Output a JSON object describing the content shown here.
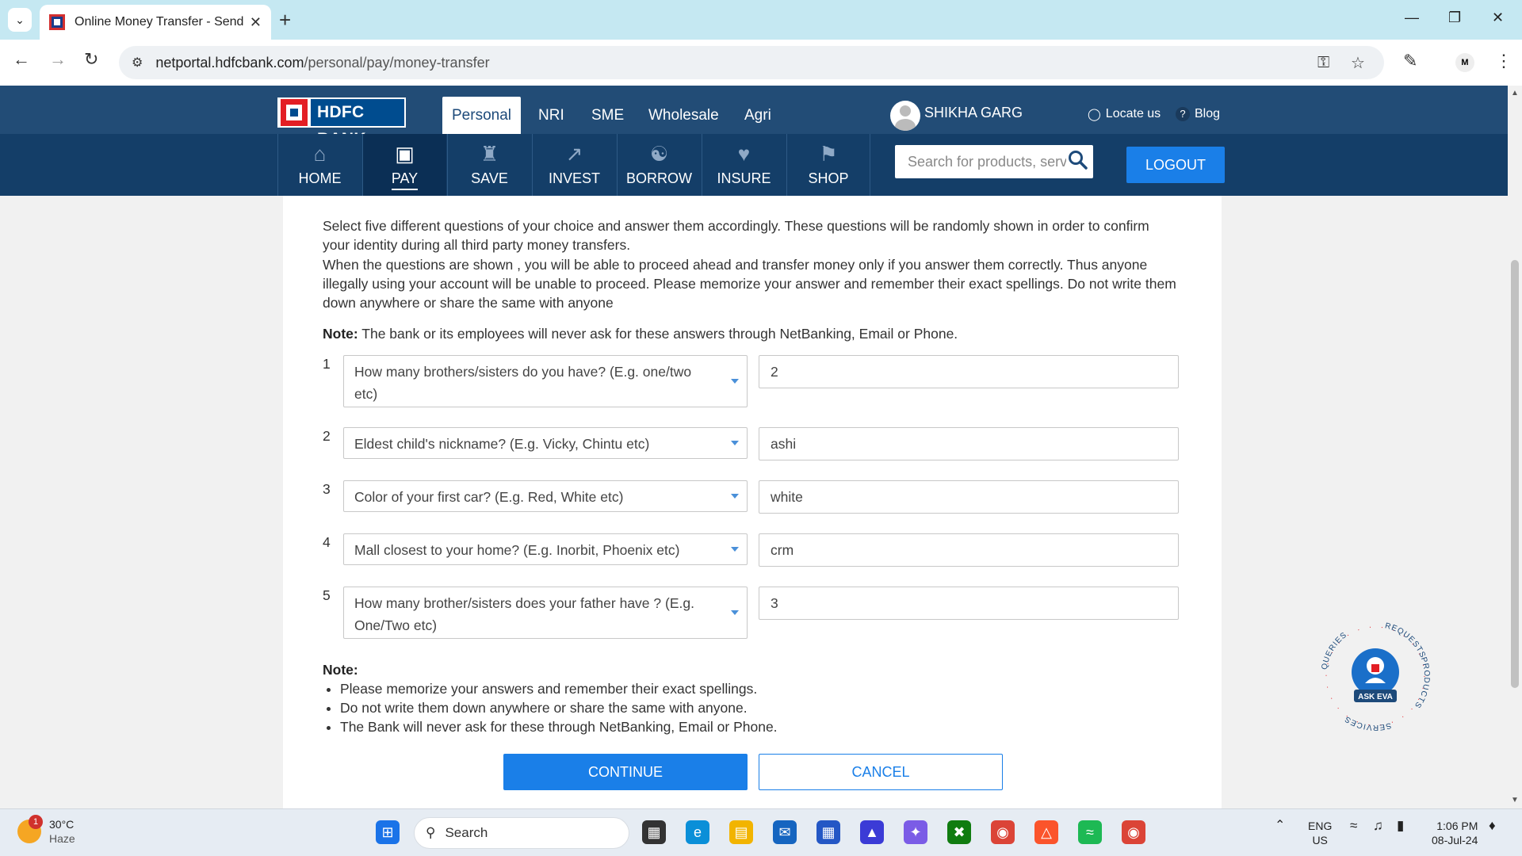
{
  "browser": {
    "tab_title": "Online Money Transfer - Send &",
    "url_host": "netportal.hdfcbank.com",
    "url_path": "/personal/pay/money-transfer",
    "profile_initial": "M"
  },
  "header": {
    "logo_text": "HDFC BANK",
    "segments": [
      "Personal",
      "NRI",
      "SME",
      "Wholesale",
      "Agri"
    ],
    "active_segment": "Personal",
    "user_name": "SHIKHA GARG",
    "locate_label": "Locate us",
    "blog_label": "Blog",
    "nav": [
      "HOME",
      "PAY",
      "SAVE",
      "INVEST",
      "BORROW",
      "INSURE",
      "SHOP"
    ],
    "active_nav": "PAY",
    "search_placeholder": "Search for products, servi",
    "logout_label": "LOGOUT"
  },
  "form": {
    "intro_1": "Select five different questions of your choice and answer them accordingly. These questions will be randomly shown in order to confirm your identity during all third party money transfers.",
    "intro_2": "When the questions are shown , you will be able to proceed ahead and transfer money only if you answer them correctly. Thus anyone illegally using your account will be unable to proceed. Please memorize your answer and remember their exact spellings. Do not write them down anywhere or share the same with anyone",
    "note_label": "Note:",
    "note_text": "The bank or its employees will never ask for these answers through NetBanking, Email or Phone.",
    "questions": [
      {
        "num": "1",
        "question": "How many brothers/sisters do you have? (E.g. one/two etc)",
        "answer": "2"
      },
      {
        "num": "2",
        "question": "Eldest child's nickname? (E.g. Vicky, Chintu etc)",
        "answer": "ashi"
      },
      {
        "num": "3",
        "question": "Color of your first car? (E.g. Red, White etc)",
        "answer": "white"
      },
      {
        "num": "4",
        "question": "Mall closest to your home? (E.g. Inorbit, Phoenix etc)",
        "answer": "crm"
      },
      {
        "num": "5",
        "question": "How many brother/sisters does your father have ? (E.g. One/Two etc)",
        "answer": "3"
      }
    ],
    "note2_label": "Note:",
    "note2_items": [
      "Please memorize your answers and remember their exact spellings.",
      "Do not write them down anywhere or share the same with anyone.",
      "The Bank will never ask for these through NetBanking, Email or Phone."
    ],
    "continue_label": "CONTINUE",
    "cancel_label": "CANCEL"
  },
  "eva": {
    "label": "ASK EVA",
    "ring": [
      "REQUESTS",
      "PRODUCTS",
      "SERVICES",
      "QUERIES"
    ]
  },
  "taskbar": {
    "temperature": "30°C",
    "weather": "Haze",
    "weather_badge": "1",
    "search_label": "Search",
    "lang_1": "ENG",
    "lang_2": "US",
    "time": "1:06 PM",
    "date": "08-Jul-24"
  },
  "colors": {
    "header_top": "#224c76",
    "header_nav": "#143e68",
    "accent_blue": "#1a7fe8",
    "hdfc_red": "#e31e24"
  }
}
